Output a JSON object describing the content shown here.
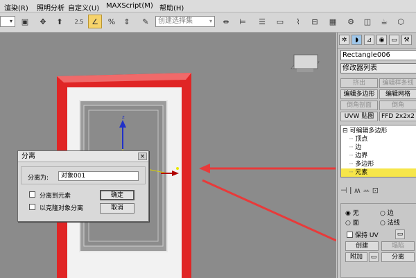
{
  "menu": {
    "items": [
      "渲染(R)",
      "照明分析",
      "自定义(U)",
      "MAXScript(M)",
      "帮助(H)"
    ]
  },
  "toolbar": {
    "zoom_label": "2.5",
    "selection_set_placeholder": "创建选择集"
  },
  "panel": {
    "object_name": "Rectangle006",
    "modifier_list": "修改器列表",
    "buttons": {
      "extrude": "挤出",
      "edit_spline": "编辑样条线",
      "edit_poly": "编辑多边形",
      "edit_mesh": "编辑网格",
      "cross_section": "倒角剖面",
      "bevel": "倒角",
      "uvw_map": "UVW 贴图",
      "ffd": "FFD 2x2x2"
    },
    "stack": {
      "root": "可编辑多边形",
      "items": [
        "顶点",
        "边",
        "边界",
        "多边形",
        "元素"
      ]
    },
    "selection": {
      "partial_label": "无",
      "edge_label": "边",
      "face_label": "面",
      "spline_label": "法线",
      "keep_uv": "保持 UV",
      "create_btn": "创建",
      "collapse_btn": "塌陷",
      "attach_btn": "附加",
      "detach_btn": "分离"
    }
  },
  "dialog": {
    "title": "分离",
    "close": "×",
    "name_label": "分离为:",
    "name_value": "对象001",
    "detach_element": "分离到元素",
    "detach_clone": "以克隆对象分离",
    "ok": "确定",
    "cancel": "取消"
  },
  "colors": {
    "frame_red": "#e02525",
    "arrow_red": "#e83a3a",
    "highlight_yellow": "#f6e64a",
    "viewport_grey": "#8b8b8b"
  }
}
